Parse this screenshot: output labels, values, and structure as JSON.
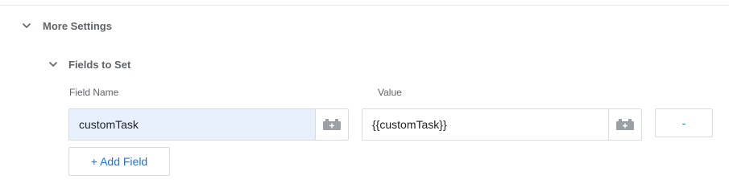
{
  "more_settings": {
    "title": "More Settings",
    "toggle_icon": "chevron-down-icon"
  },
  "fields_to_set": {
    "title": "Fields to Set",
    "toggle_icon": "chevron-down-icon",
    "columns": {
      "field_name": "Field Name",
      "value": "Value"
    },
    "rows": [
      {
        "field_name": "customTask",
        "value": "{{customTask}}",
        "variable_icon": "lego-brick-plus-icon",
        "remove_label": "-"
      }
    ],
    "add_button_label": "+ Add Field"
  },
  "colors": {
    "autofill_bg": "#e8f0fe",
    "accent": "#1a73e8",
    "border": "#dadce0",
    "muted_text": "#5f6368"
  }
}
